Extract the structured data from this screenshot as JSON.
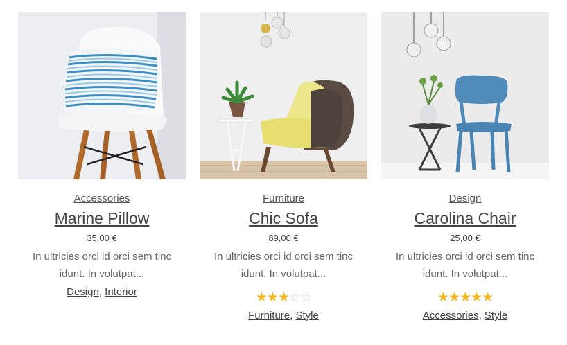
{
  "products": [
    {
      "category": "Accessories",
      "title": "Marine Pillow",
      "price": "35,00 €",
      "excerpt": "In ultricies orci id orci sem tinc idunt. In volutpat...",
      "tags": [
        "Design",
        "Interior"
      ],
      "rating": null
    },
    {
      "category": "Furniture",
      "title": "Chic Sofa",
      "price": "89,00 €",
      "excerpt": "In ultricies orci id orci sem tinc idunt. In volutpat...",
      "tags": [
        "Furniture",
        "Style"
      ],
      "rating": 3
    },
    {
      "category": "Design",
      "title": "Carolina Chair",
      "price": "25,00 €",
      "excerpt": "In ultricies orci id orci sem tinc idunt. In volutpat...",
      "tags": [
        "Accessories",
        "Style"
      ],
      "rating": 5
    }
  ],
  "rating_max": 5,
  "colors": {
    "star": "#f5b51a",
    "star_empty": "#d6d6d6",
    "watermark": "#e53935"
  }
}
